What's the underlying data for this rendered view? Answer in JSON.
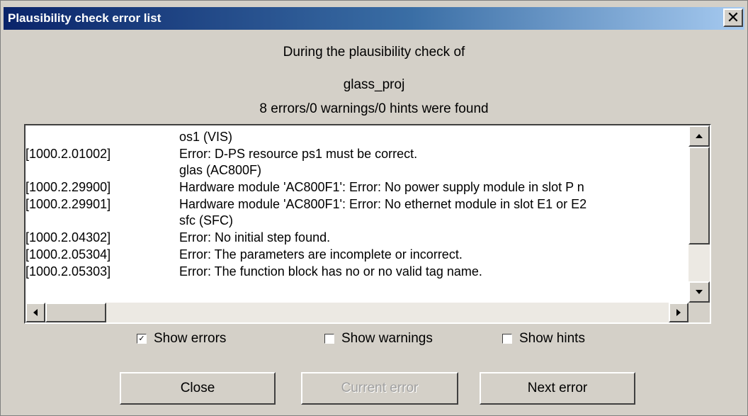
{
  "window": {
    "title": "Plausibility check error list",
    "close_glyph": "✕"
  },
  "header": {
    "line1": "During the  plausibility check of",
    "line2": "glass_proj",
    "line3": "8 errors/0 warnings/0 hints were found"
  },
  "list": {
    "rows": [
      {
        "code": "",
        "text": "os1 (VIS)"
      },
      {
        "code": "[1000.2.01002]",
        "text": "Error: D-PS resource ps1 must be correct."
      },
      {
        "code": "",
        "text": "glas (AC800F)"
      },
      {
        "code": "[1000.2.29900]",
        "text": "Hardware module 'AC800F1': Error: No power supply module in slot P n"
      },
      {
        "code": "[1000.2.29901]",
        "text": "Hardware module 'AC800F1': Error: No ethernet module in slot E1 or E2"
      },
      {
        "code": "",
        "text": "sfc (SFC)"
      },
      {
        "code": "[1000.2.04302]",
        "text": "Error: No initial step found."
      },
      {
        "code": "[1000.2.05304]",
        "text": "Error: The parameters are incomplete or incorrect."
      },
      {
        "code": "[1000.2.05303]",
        "text": "Error: The function block has no or no valid tag name."
      }
    ]
  },
  "options": {
    "show_errors": {
      "label": "Show errors",
      "checked": true
    },
    "show_warnings": {
      "label": "Show warnings",
      "checked": false
    },
    "show_hints": {
      "label": "Show hints",
      "checked": false
    }
  },
  "buttons": {
    "close": "Close",
    "current_error": "Current error",
    "next_error": "Next error"
  }
}
